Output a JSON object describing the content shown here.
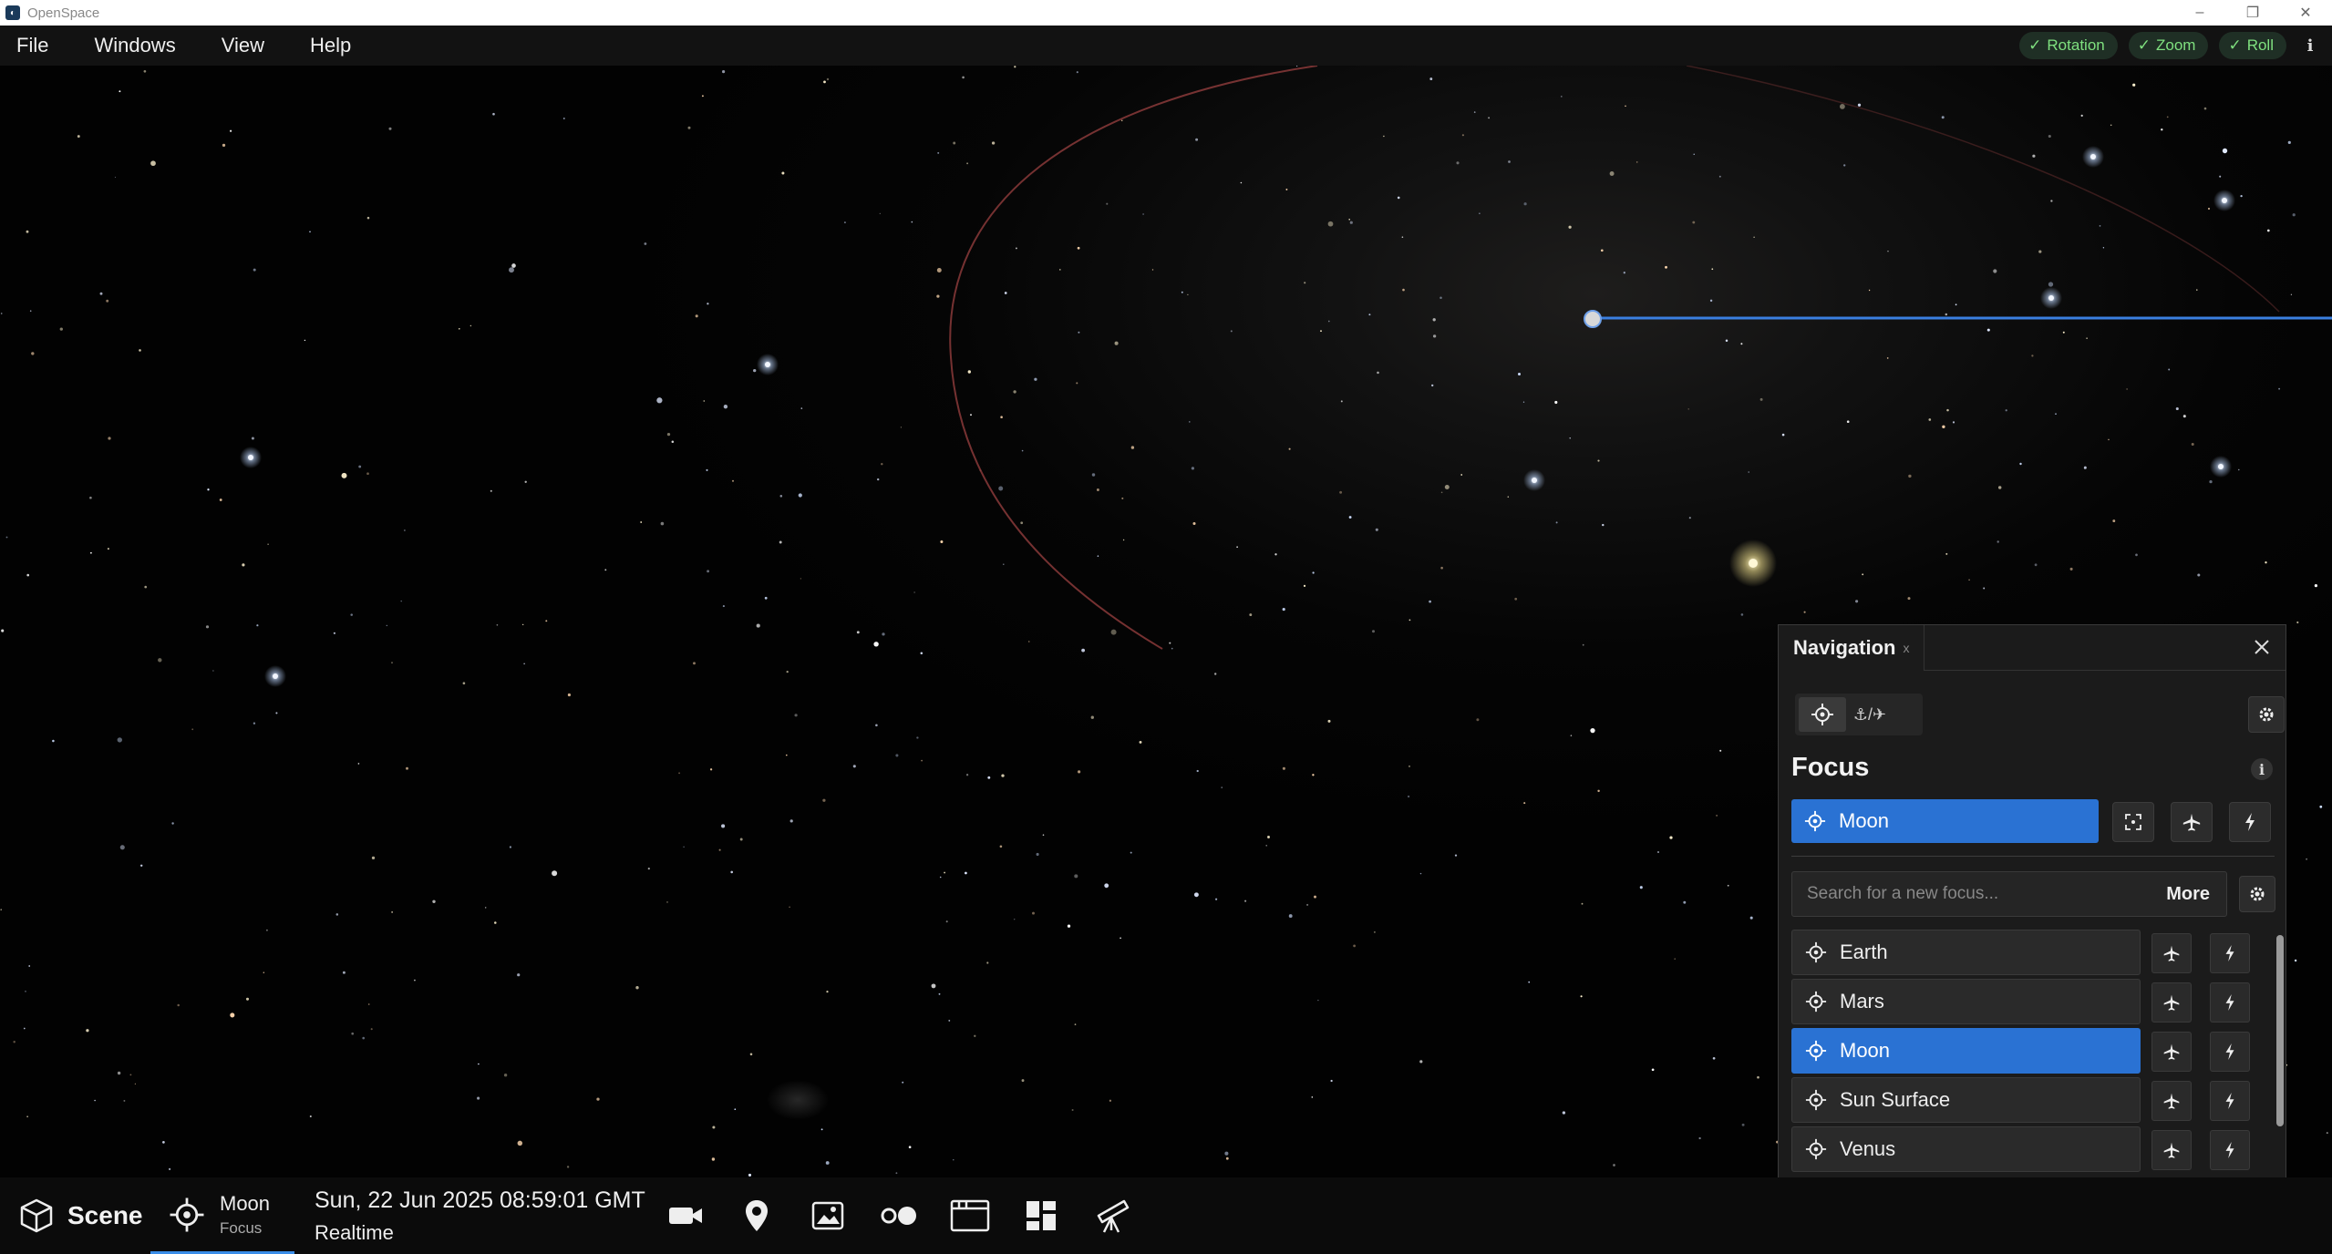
{
  "window": {
    "title": "OpenSpace",
    "controls": [
      "minimize-icon",
      "maximize-icon",
      "close-icon"
    ]
  },
  "menu": {
    "items": [
      "File",
      "Windows",
      "View",
      "Help"
    ]
  },
  "toggles": [
    {
      "label": "Rotation",
      "checked": true
    },
    {
      "label": "Zoom",
      "checked": true
    },
    {
      "label": "Roll",
      "checked": true
    }
  ],
  "toggle_color": "#7fe07f",
  "navigation": {
    "tab_title": "Navigation",
    "tab_close": "x",
    "modes": [
      "focus-icon",
      "anchor-aim-icon"
    ],
    "focus_heading": "Focus",
    "current_focus": "Moon",
    "search_placeholder": "Search for a new focus...",
    "more_label": "More",
    "list": [
      {
        "name": "Earth",
        "selected": false
      },
      {
        "name": "Mars",
        "selected": false
      },
      {
        "name": "Moon",
        "selected": true
      },
      {
        "name": "Sun Surface",
        "selected": false
      },
      {
        "name": "Venus",
        "selected": false
      }
    ]
  },
  "bottom": {
    "scene_label": "Scene",
    "focus_name": "Moon",
    "focus_sub": "Focus",
    "datetime": "Sun, 22 Jun 2025 08:59:01 GMT",
    "time_mode": "Realtime",
    "tool_icons": [
      "camera-icon",
      "location-pin-icon",
      "image-icon",
      "dots-icon",
      "browser-window-icon",
      "dashboard-icon",
      "telescope-icon"
    ]
  },
  "colors": {
    "accent": "#2a72d3",
    "orbit": "#8a3a3a",
    "trail": "#3a7fe0"
  }
}
